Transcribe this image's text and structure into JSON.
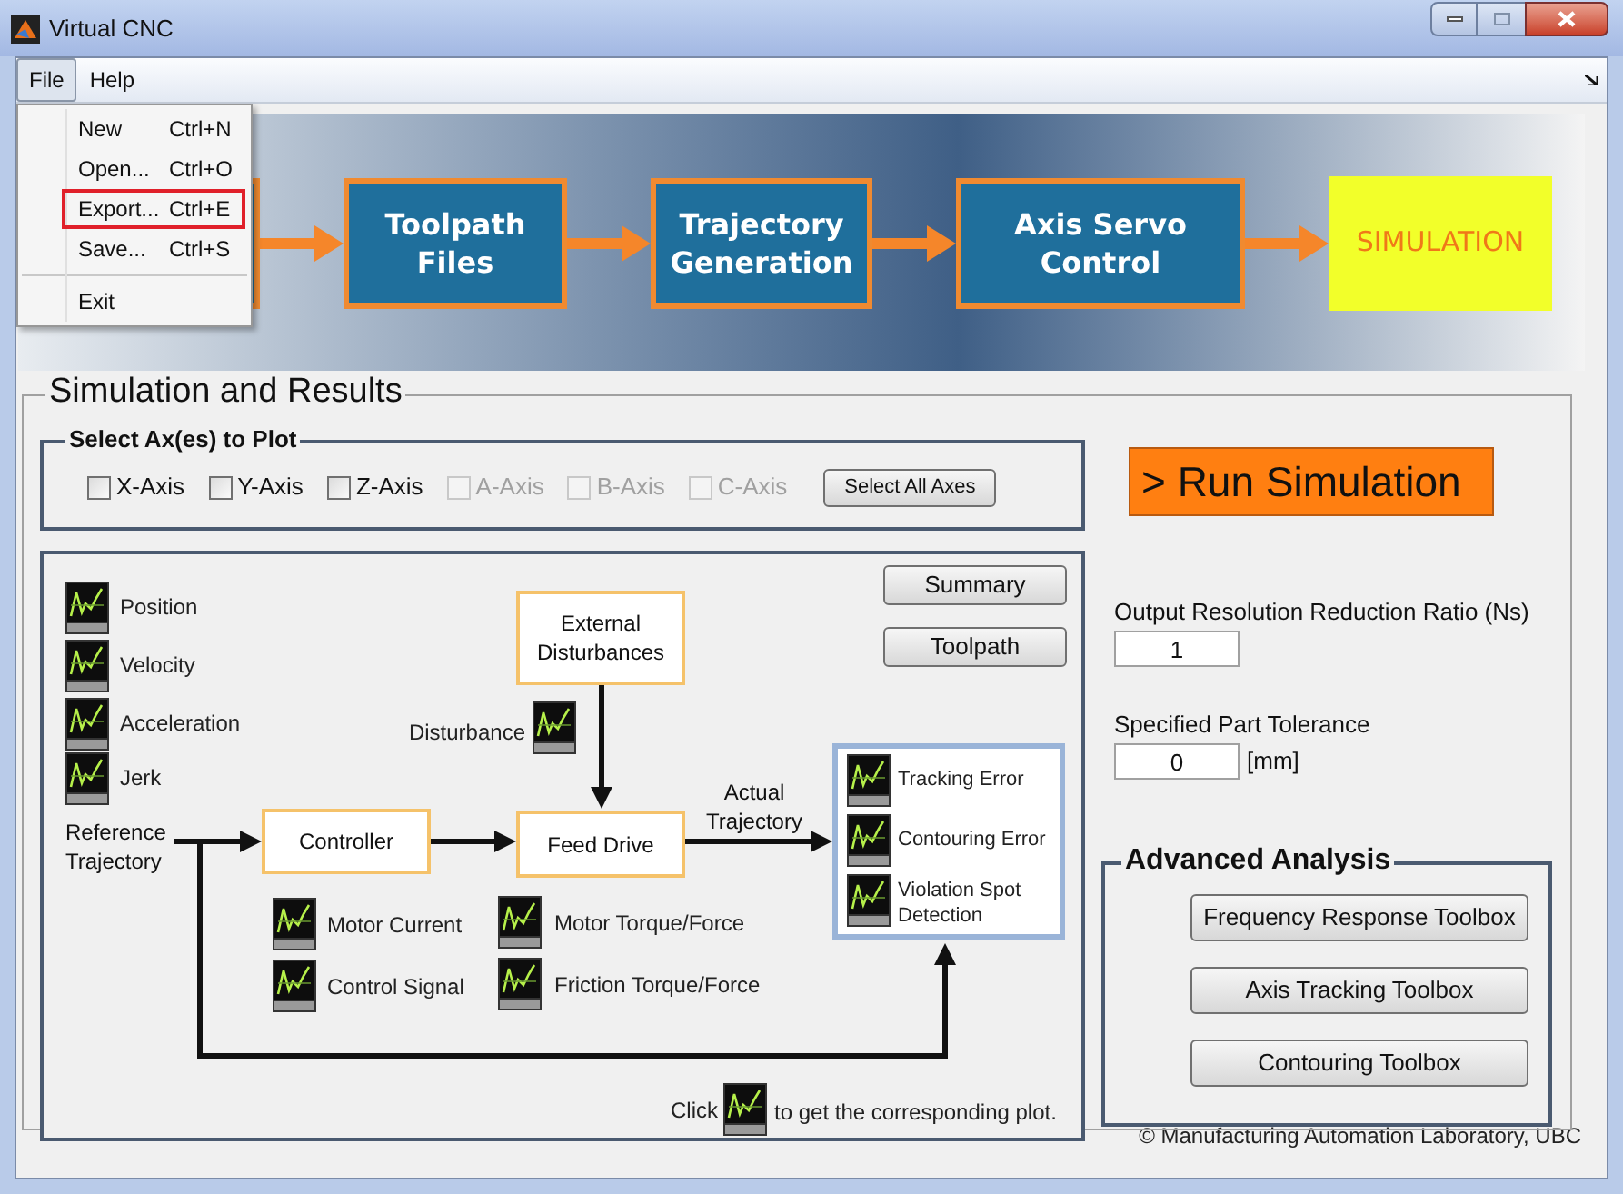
{
  "window": {
    "title": "Virtual CNC"
  },
  "menu_bar": [
    {
      "label": "File",
      "selected": true
    },
    {
      "label": "Help",
      "selected": false
    }
  ],
  "file_menu": [
    {
      "kind": "item",
      "label": "New",
      "shortcut": "Ctrl+N",
      "highlighted": false
    },
    {
      "kind": "item",
      "label": "Open...",
      "shortcut": "Ctrl+O",
      "highlighted": false
    },
    {
      "kind": "item",
      "label": "Export...",
      "shortcut": "Ctrl+E",
      "highlighted": true
    },
    {
      "kind": "item",
      "label": "Save...",
      "shortcut": "Ctrl+S",
      "highlighted": false
    },
    {
      "kind": "separator"
    },
    {
      "kind": "item",
      "label": "Exit",
      "highlighted": false
    }
  ],
  "banner": {
    "stages": [
      {
        "kind": "process",
        "label": "Toolpath Files"
      },
      {
        "kind": "process",
        "label": "Trajectory Generation"
      },
      {
        "kind": "process",
        "label": "Axis Servo Control"
      },
      {
        "kind": "current",
        "label": "SIMULATION"
      }
    ]
  },
  "simulation": {
    "title": "Simulation and Results",
    "axes_group": {
      "title": "Select Ax(es) to Plot",
      "axes": [
        {
          "label": "X-Axis",
          "checked": false,
          "disabled": false
        },
        {
          "label": "Y-Axis",
          "checked": false,
          "disabled": false
        },
        {
          "label": "Z-Axis",
          "checked": false,
          "disabled": false
        },
        {
          "label": "A-Axis",
          "checked": false,
          "disabled": true
        },
        {
          "label": "B-Axis",
          "checked": false,
          "disabled": true
        },
        {
          "label": "C-Axis",
          "checked": false,
          "disabled": true
        }
      ],
      "select_all_button": "Select All Axes"
    },
    "run_button": "> Run Simulation",
    "diagram": {
      "buttons": [
        "Summary",
        "Toolpath"
      ],
      "reference_plots": [
        "Position",
        "Velocity",
        "Acceleration",
        "Jerk"
      ],
      "reference_label": "Reference Trajectory",
      "controller": "Controller",
      "feed_drive": "Feed Drive",
      "disturbances": "External Disturbances",
      "disturbance_plot": "Disturbance",
      "actual_label": "Actual Trajectory",
      "controller_plots": [
        "Motor Current",
        "Control Signal"
      ],
      "drive_plots": [
        "Motor Torque/Force",
        "Friction Torque/Force"
      ],
      "output_plots": [
        "Tracking Error",
        "Contouring Error",
        "Violation Spot Detection"
      ],
      "hint": {
        "before": "Click",
        "after": "to get the corresponding plot."
      }
    },
    "settings": [
      {
        "label": "Output Resolution Reduction Ratio (Ns)",
        "value": "1"
      },
      {
        "label": "Specified Part Tolerance",
        "value": "0",
        "unit": "[mm]"
      }
    ],
    "advanced_analysis": {
      "title": "Advanced Analysis",
      "buttons": [
        "Frequency Response Toolbox",
        "Axis Tracking Toolbox",
        "Contouring Toolbox"
      ]
    }
  },
  "footer": "© Manufacturing Automation Laboratory, UBC"
}
